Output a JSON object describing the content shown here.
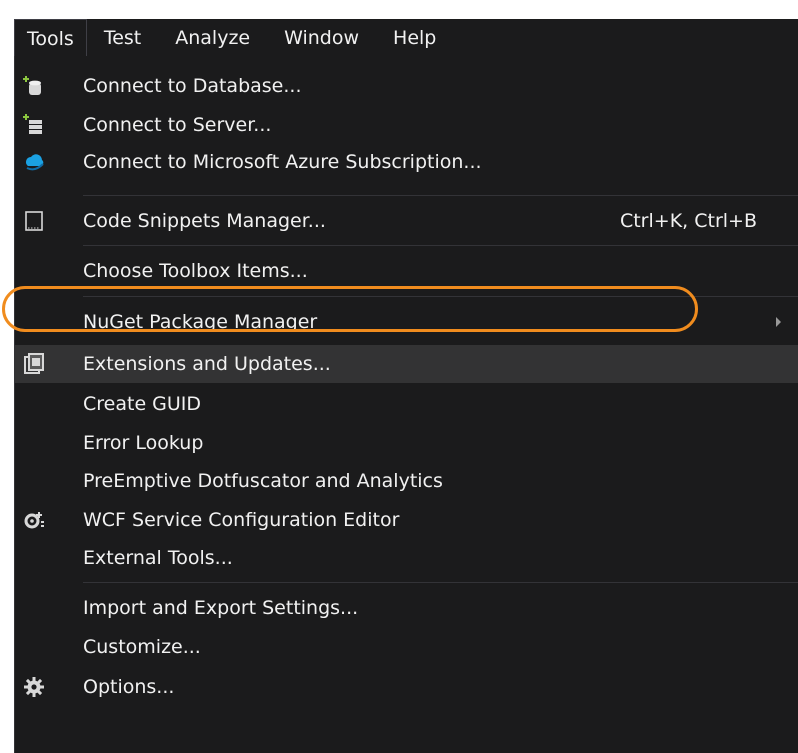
{
  "menubar": {
    "items": [
      {
        "label": "Tools",
        "active": true
      },
      {
        "label": "Test"
      },
      {
        "label": "Analyze"
      },
      {
        "label": "Window"
      },
      {
        "label": "Help"
      }
    ]
  },
  "menu": {
    "items": [
      {
        "label": "Connect to Database...",
        "icon": "database-icon"
      },
      {
        "label": "Connect to Server...",
        "icon": "server-icon"
      },
      {
        "label": "Connect to Microsoft Azure Subscription...",
        "icon": "azure-cloud-icon"
      },
      {
        "label": "Code Snippets Manager...",
        "icon": "snippet-icon",
        "shortcut": "Ctrl+K, Ctrl+B"
      },
      {
        "label": "Choose Toolbox Items..."
      },
      {
        "label": "NuGet Package Manager",
        "submenu": true
      },
      {
        "label": "Extensions and Updates...",
        "icon": "extensions-icon",
        "highlighted": true
      },
      {
        "label": "Create GUID"
      },
      {
        "label": "Error Lookup"
      },
      {
        "label": "PreEmptive Dotfuscator and Analytics"
      },
      {
        "label": "WCF Service Configuration Editor",
        "icon": "wcf-config-icon"
      },
      {
        "label": "External Tools..."
      },
      {
        "label": "Import and Export Settings..."
      },
      {
        "label": "Customize..."
      },
      {
        "label": "Options...",
        "icon": "gear-icon"
      }
    ]
  },
  "colors": {
    "menu_background": "#1b1b1c",
    "text": "#f1f1f1",
    "highlight": "#333334",
    "callout": "#f08c1e",
    "azure": "#1ba1e2"
  }
}
